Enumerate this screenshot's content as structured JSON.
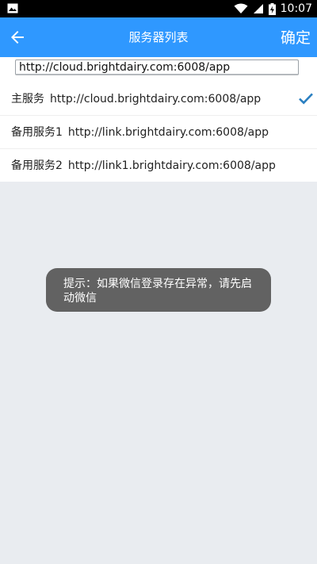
{
  "status_bar": {
    "time": "10:07"
  },
  "app_bar": {
    "title": "服务器列表",
    "confirm_label": "确定"
  },
  "url_input": {
    "value": "http://cloud.brightdairy.com:6008/app"
  },
  "servers": [
    {
      "label": "主服务",
      "url": "http://cloud.brightdairy.com:6008/app",
      "selected": true
    },
    {
      "label": "备用服务1",
      "url": "http://link.brightdairy.com:6008/app",
      "selected": false
    },
    {
      "label": "备用服务2",
      "url": "http://link1.brightdairy.com:6008/app",
      "selected": false
    }
  ],
  "toast": {
    "text": "提示：如果微信登录存在异常，请先启动微信"
  },
  "colors": {
    "app_bar": "#2f98ff",
    "check": "#2a7fc1",
    "background": "#e9ecf0",
    "toast": "#626262"
  }
}
